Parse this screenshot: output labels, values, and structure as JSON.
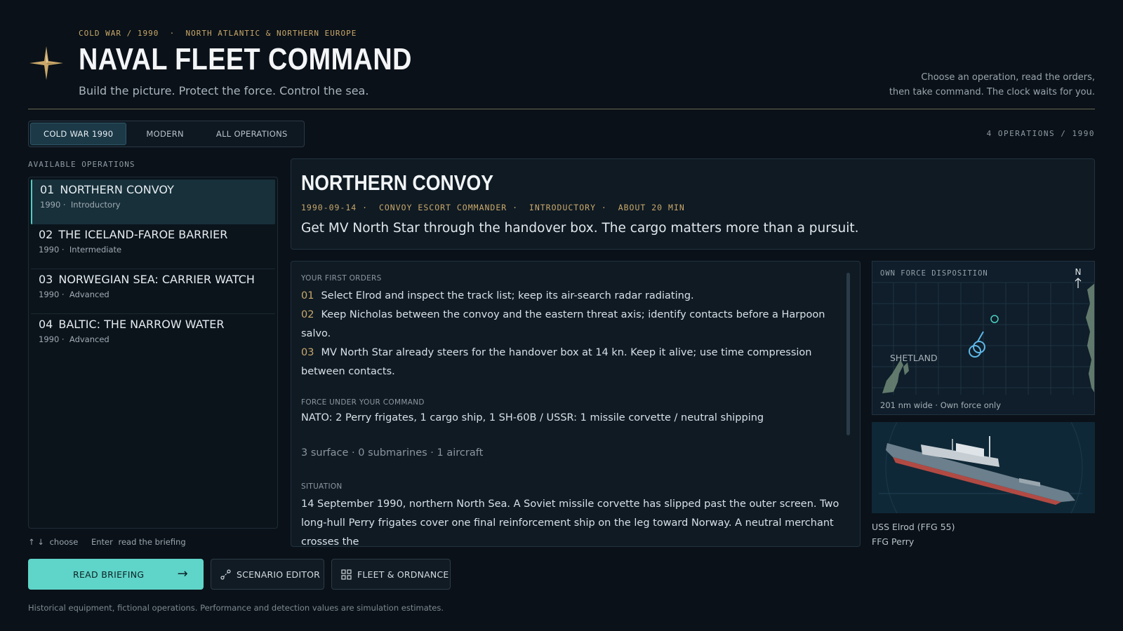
{
  "header": {
    "kicker_era": "COLD WAR / 1990",
    "kicker_region": "NORTH ATLANTIC & NORTHERN EUROPE",
    "title": "NAVAL FLEET COMMAND",
    "tagline": "Build the picture. Protect the force. Control the sea.",
    "hint_line1": "Choose an operation, read the orders,",
    "hint_line2": "then take command. The clock waits for you.",
    "emblem_icon": "compass-star-icon"
  },
  "tabs": [
    {
      "label": "COLD WAR 1990",
      "active": true
    },
    {
      "label": "MODERN",
      "active": false
    },
    {
      "label": "ALL OPERATIONS",
      "active": false
    }
  ],
  "ops_count": "4 OPERATIONS  /  1990",
  "sidebar": {
    "label": "AVAILABLE OPERATIONS",
    "operations": [
      {
        "num": "01",
        "title": "NORTHERN CONVOY",
        "year": "1990",
        "difficulty": "Introductory",
        "active": true
      },
      {
        "num": "02",
        "title": "THE ICELAND-FAROE BARRIER",
        "year": "1990",
        "difficulty": "Intermediate",
        "active": false
      },
      {
        "num": "03",
        "title": "NORWEGIAN SEA: CARRIER WATCH",
        "year": "1990",
        "difficulty": "Advanced",
        "active": false
      },
      {
        "num": "04",
        "title": "BALTIC: THE NARROW WATER",
        "year": "1990",
        "difficulty": "Advanced",
        "active": false
      }
    ],
    "keys_arrows": "↑ ↓",
    "keys_choose": "choose",
    "keys_enter": "Enter",
    "keys_read": "read the briefing"
  },
  "briefing": {
    "title": "NORTHERN CONVOY",
    "date": "1990-09-14",
    "role": "CONVOY ESCORT COMMANDER",
    "level": "INTRODUCTORY",
    "duration": "ABOUT 20 MIN",
    "summary": "Get MV North Star through the handover box. The cargo matters more than a pursuit."
  },
  "orders": {
    "label": "YOUR FIRST ORDERS",
    "items": [
      {
        "num": "01",
        "text": "Select Elrod and inspect the track list; keep its air-search radar radiating."
      },
      {
        "num": "02",
        "text": "Keep Nicholas between the convoy and the eastern threat axis; identify contacts before a Harpoon salvo."
      },
      {
        "num": "03",
        "text": "MV North Star already steers for the handover box at 14 kn. Keep it alive; use time compression between contacts."
      }
    ],
    "force_label": "FORCE UNDER YOUR COMMAND",
    "force_text": "NATO: 2 Perry frigates, 1 cargo ship, 1 SH-60B / USSR: 1 missile corvette / neutral shipping",
    "counts": "3 surface  ·  0 submarines  ·  1 aircraft",
    "situation_label": "SITUATION",
    "situation_text": "14 September 1990, northern North Sea. A Soviet missile corvette has slipped past the outer screen. Two long-hull Perry frigates cover one final reinforcement ship on the leg toward Norway. A neutral merchant crosses the"
  },
  "map": {
    "label": "OWN FORCE DISPOSITION",
    "north": "N",
    "place": "SHETLAND",
    "footer": "201 nm wide  ·  Own force only"
  },
  "ship": {
    "name": "USS Elrod (FFG 55)",
    "class": "FFG Perry"
  },
  "buttons": {
    "read_briefing": "READ BRIEFING",
    "scenario_editor": "SCENARIO EDITOR",
    "fleet_ordnance": "FLEET & ORDNANCE"
  },
  "disclaimer": "Historical equipment, fictional operations. Performance and detection values are simulation estimates.",
  "colors": {
    "background": "#0a1118",
    "accent_teal": "#5fd4c8",
    "accent_gold": "#c9a86a"
  }
}
